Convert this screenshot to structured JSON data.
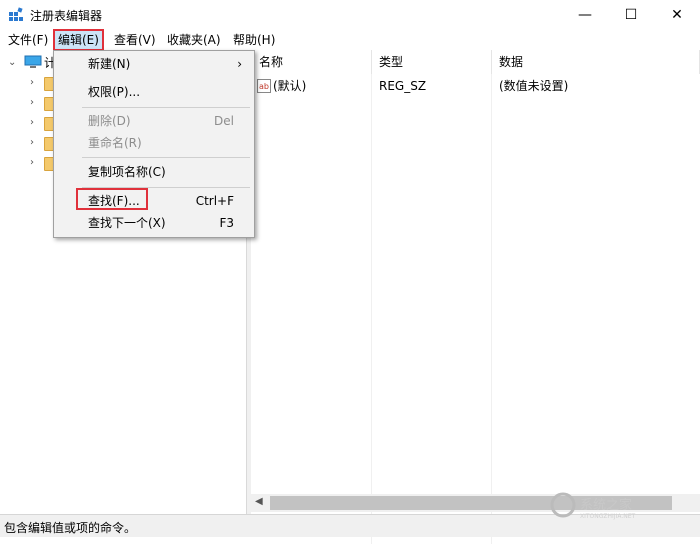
{
  "window": {
    "title": "注册表编辑器",
    "icon": "regedit-icon",
    "controls": {
      "minimize": "—",
      "maximize": "☐",
      "close": "✕"
    }
  },
  "menubar": [
    {
      "label": "文件(F)"
    },
    {
      "label": "编辑(E)"
    },
    {
      "label": "查看(V)"
    },
    {
      "label": "收藏夹(A)"
    },
    {
      "label": "帮助(H)"
    }
  ],
  "tree": {
    "root_label": "计",
    "children_count_visible": 5
  },
  "list": {
    "columns": [
      "名称",
      "类型",
      "数据"
    ],
    "rows": [
      {
        "icon": "string-value-icon",
        "name": "(默认)",
        "type": "REG_SZ",
        "data": "(数值未设置)"
      }
    ]
  },
  "edit_menu": {
    "items": [
      {
        "label": "新建(N)",
        "shortcut": "",
        "submenu": "›",
        "disabled": false
      },
      {
        "label": "权限(P)...",
        "shortcut": "",
        "disabled": false
      },
      {
        "label": "删除(D)",
        "shortcut": "Del",
        "disabled": true
      },
      {
        "label": "重命名(R)",
        "shortcut": "",
        "disabled": true
      },
      {
        "label": "复制项名称(C)",
        "shortcut": "",
        "disabled": false
      },
      {
        "label": "查找(F)...",
        "shortcut": "Ctrl+F",
        "disabled": false
      },
      {
        "label": "查找下一个(X)",
        "shortcut": "F3",
        "disabled": false
      }
    ]
  },
  "statusbar": {
    "text": "包含编辑值或项的命令。"
  },
  "colors": {
    "highlight_box": "#e0313b",
    "menu_selected": "#cce4f7",
    "folder": "#f4c96b"
  }
}
